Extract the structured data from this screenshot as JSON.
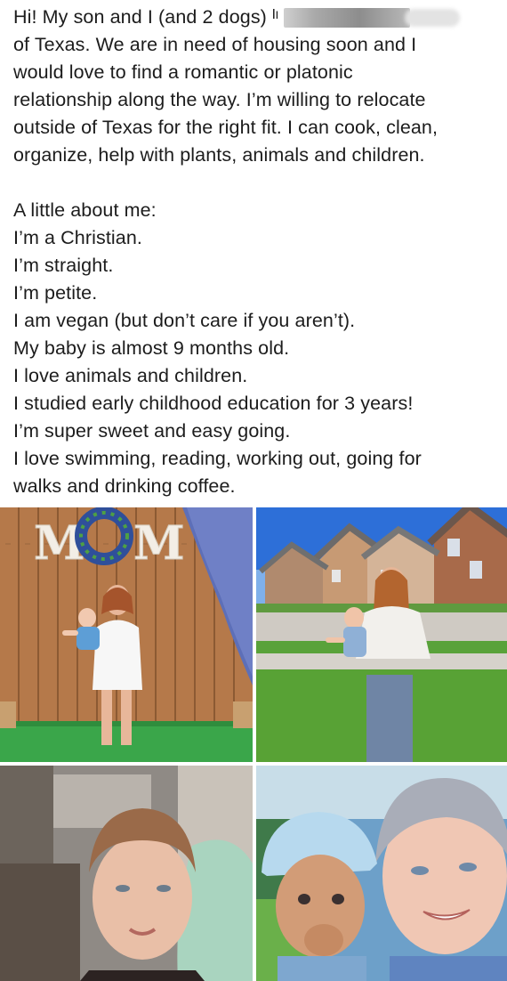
{
  "post": {
    "lines": [
      "Hi! My son and I (and 2 dogs) ᴵᶦ",
      "of Texas. We are in need of housing soon and I",
      "would love to find a romantic or platonic",
      "relationship along the way. I’m willing to relocate",
      "outside of Texas for the right fit. I can cook, clean,",
      "organize, help with plants, animals and children.",
      "",
      "A little about me:",
      "I’m a Christian.",
      "I’m straight.",
      "I’m petite.",
      "I am vegan (but don’t care if you aren’t).",
      "My baby is almost 9 months old.",
      "I love animals and children.",
      "I studied early childhood education for 3 years!",
      "I’m super sweet and easy going.",
      "I love swimming, reading, working out, going for",
      "walks and drinking coffee."
    ]
  },
  "photos": {
    "mom_sign": {
      "letters": [
        "M",
        "M"
      ]
    }
  },
  "colors": {
    "text": "#1c1c1c",
    "wood": "#b47a4a",
    "grass": "#3aa64a",
    "sky": "#2d6fd8",
    "brick": "#a86a4a"
  }
}
